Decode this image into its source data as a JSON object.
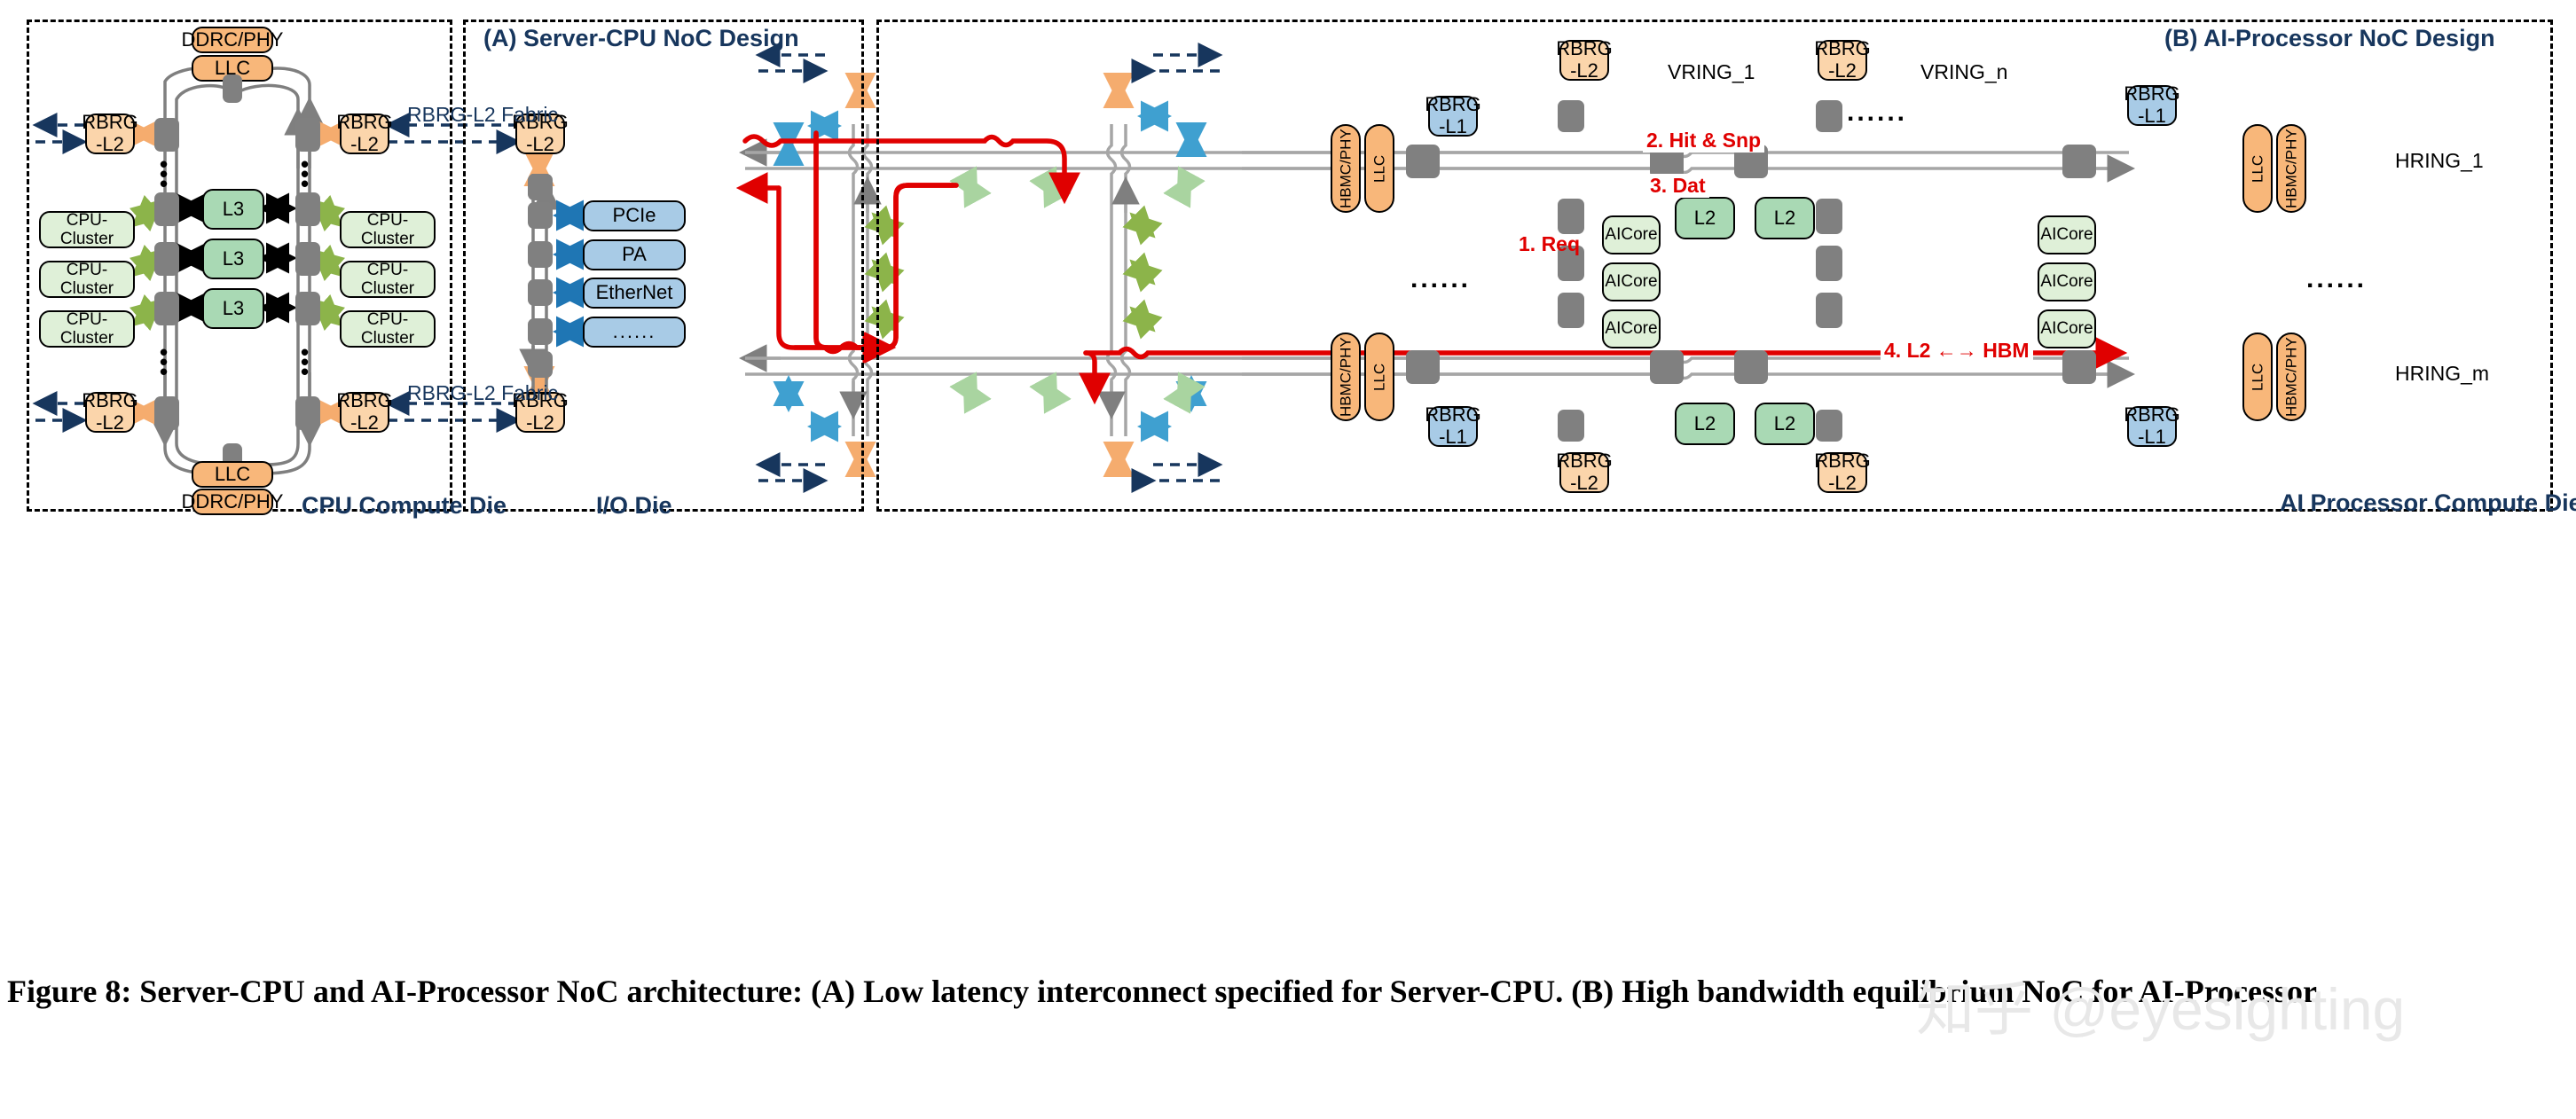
{
  "figure": {
    "caption": "Figure 8: Server-CPU and AI-Processor NoC architecture: (A) Low latency interconnect specified for Server-CPU. (B) High bandwidth equilibrium NoC for AI-Processor.",
    "watermark": "知乎 @eyesighting"
  },
  "panel_a": {
    "title": "(A) Server-CPU NoC Design",
    "cpu_die_label": "CPU Compute Die",
    "io_die_label": "I/O Die",
    "top_memory": {
      "phy": "DDRC/PHY",
      "llc": "LLC"
    },
    "bottom_memory": {
      "llc": "LLC",
      "phy": "DDRC/PHY"
    },
    "rbrg_l2": "RBRG\n-L2",
    "rbrg_label_line1": "RBRG",
    "rbrg_label_line2": "-L2",
    "fabric_label": "RBRG-L2 Fabric",
    "l3_blocks": [
      "L3",
      "L3",
      "L3"
    ],
    "cpu_clusters_left": [
      "CPU-Cluster",
      "CPU-Cluster",
      "CPU-Cluster"
    ],
    "cpu_clusters_right": [
      "CPU-Cluster",
      "CPU-Cluster",
      "CPU-Cluster"
    ],
    "io_devices": [
      "PCIe",
      "PA",
      "EtherNet",
      "......"
    ],
    "vertical_ellipsis": "⋮"
  },
  "panel_b": {
    "title": "(B) AI-Processor NoC Design",
    "die_label": "AI Processor Compute Die",
    "vring_labels": [
      "VRING_1",
      "VRING_n"
    ],
    "hring_labels": [
      "HRING_1",
      "HRING_m"
    ],
    "rbrg_l2_line1": "RBRG",
    "rbrg_l2_line2": "-L2",
    "rbrg_l1_line1": "RBRG",
    "rbrg_l1_line2": "-L1",
    "hbm_phy": "HBMC/PHY",
    "llc": "LLC",
    "l2": "L2",
    "aicore": "AICore",
    "ellipsis": "......",
    "flow_steps": [
      "1. Req",
      "2. Hit & Snp",
      "3. Dat",
      "4. L2 ←→ HBM"
    ]
  },
  "colors": {
    "title_blue": "#17365d",
    "orange_light": "#fbd5ab",
    "orange_dark": "#f8b77a",
    "green_light": "#dff0d8",
    "green_dark": "#a9d9b4",
    "blue_light": "#a8cbe6",
    "node_gray": "#808080",
    "red_flow": "#e00000",
    "ring_gray": "#7f7f7f",
    "arrow_blue": "#1f76b4",
    "arrow_green": "#8cb44a",
    "arrow_orange": "#f5ac6e",
    "arrow_navy": "#17365d"
  }
}
